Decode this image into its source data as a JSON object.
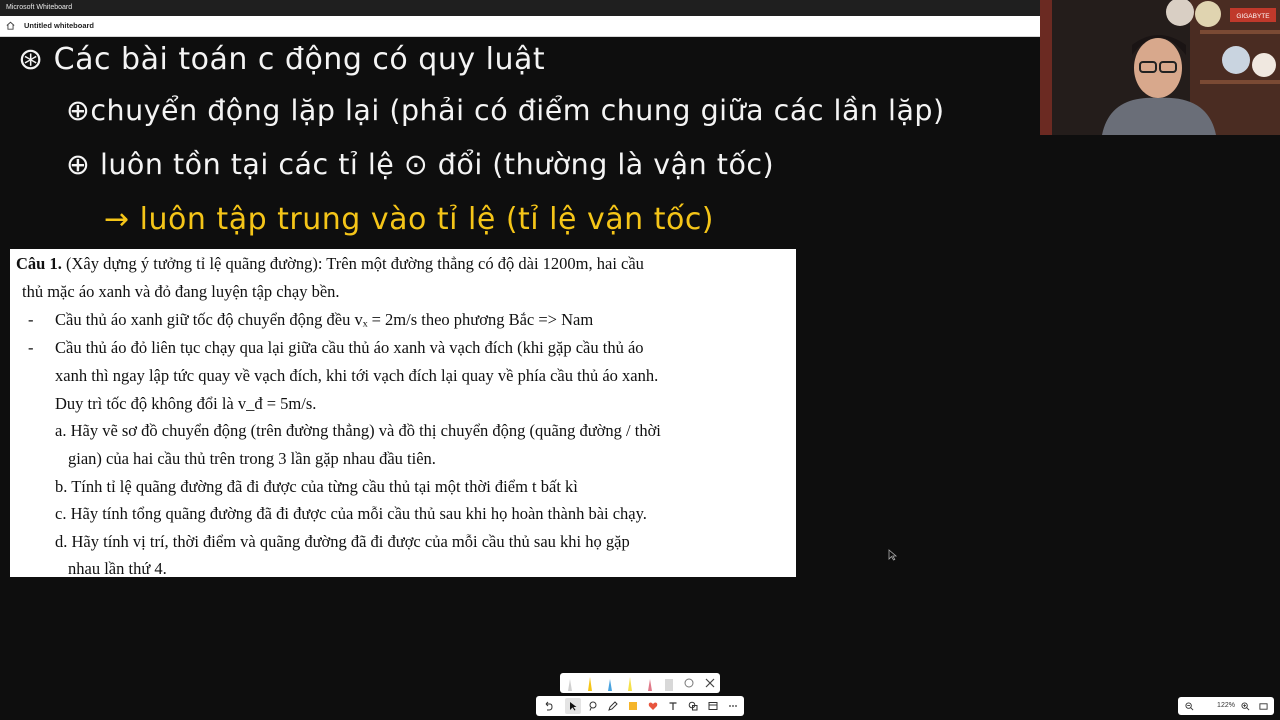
{
  "window": {
    "app_title": "Microsoft Whiteboard",
    "board_title": "Untitled whiteboard"
  },
  "handwriting": {
    "line1": "⊛ Các bài toán c động có quy luật",
    "line2": "⊕chuyển động lặp lại (phải có điểm chung giữa các lần lặp)",
    "line3": "⊕ luôn tồn tại các tỉ lệ ⊙ đổi (thường là vận tốc)",
    "line4": "→ luôn tập trung vào tỉ lệ (tỉ lệ vận tốc)"
  },
  "problem": {
    "heading": "Câu 1.",
    "line1": "(Xây dựng ý tưởng tỉ lệ quãng đường): Trên một đường thẳng có độ dài 1200m, hai cầu",
    "line2": "thủ mặc áo xanh và đỏ đang luyện tập chạy bền.",
    "bullet1": "Cầu thủ áo xanh giữ tốc độ chuyển động đều vₓ = 2m/s theo phương Bắc => Nam",
    "bullet2_l1": "Cầu thủ áo đỏ liên tục chạy qua lại giữa cầu thủ áo xanh và vạch đích (khi gặp cầu thủ áo",
    "bullet2_l2": "xanh thì ngay lập tức quay về vạch đích, khi tới vạch đích lại quay về phía cầu thủ áo xanh.",
    "bullet2_l3": "Duy trì tốc độ không đổi là v_đ = 5m/s.",
    "a_l1": "a. Hãy vẽ sơ đồ chuyển động (trên đường thẳng) và đồ thị chuyển động (quãng đường / thời",
    "a_l2": "gian) của hai cầu thủ trên trong 3 lần gặp nhau đầu tiên.",
    "b": "b. Tính tỉ lệ quãng đường đã đi được của từng cầu thủ tại một thời điểm t bất kì",
    "c": "c. Hãy tính tổng quãng đường đã đi được của mỗi cầu thủ sau khi họ hoàn thành bài chạy.",
    "d_l1": "d. Hãy tính vị trí, thời điểm và quãng đường đã đi được của mỗi cầu thủ sau khi họ gặp",
    "d_l2": "nhau lần thứ 4."
  },
  "webcam": {
    "sign": "GIGABYTE"
  },
  "zoom": {
    "level": "122%"
  },
  "icons": [
    "home-icon",
    "undo-icon",
    "select-icon",
    "lasso-icon",
    "pen-icon",
    "sticky-note-icon",
    "reaction-icon",
    "text-icon",
    "shapes-icon",
    "insert-icon",
    "more-icon",
    "zoom-out-icon",
    "zoom-in-icon",
    "fit-screen-icon",
    "close-icon",
    "eraser-icon",
    "ruler-icon"
  ],
  "colors": {
    "handwriting_white": "#f4f4f4",
    "handwriting_yellow": "#f5c518",
    "canvas": "#0e0e0e"
  }
}
